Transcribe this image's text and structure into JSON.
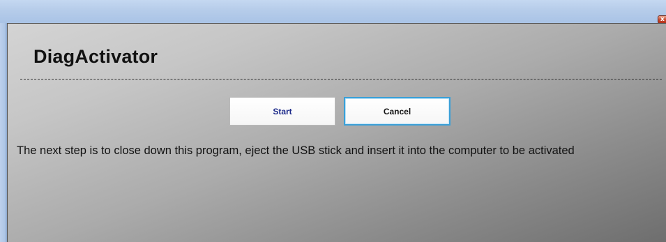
{
  "window": {
    "close_glyph": "x"
  },
  "app": {
    "title": "DiagActivator"
  },
  "buttons": {
    "start_label": "Start",
    "cancel_label": "Cancel"
  },
  "message": {
    "text": "The next step is to close down this program, eject the USB stick and insert it into the computer to be activated"
  },
  "colors": {
    "start_text": "#1c2a8a",
    "cancel_focus_border": "#3aa0d8"
  }
}
